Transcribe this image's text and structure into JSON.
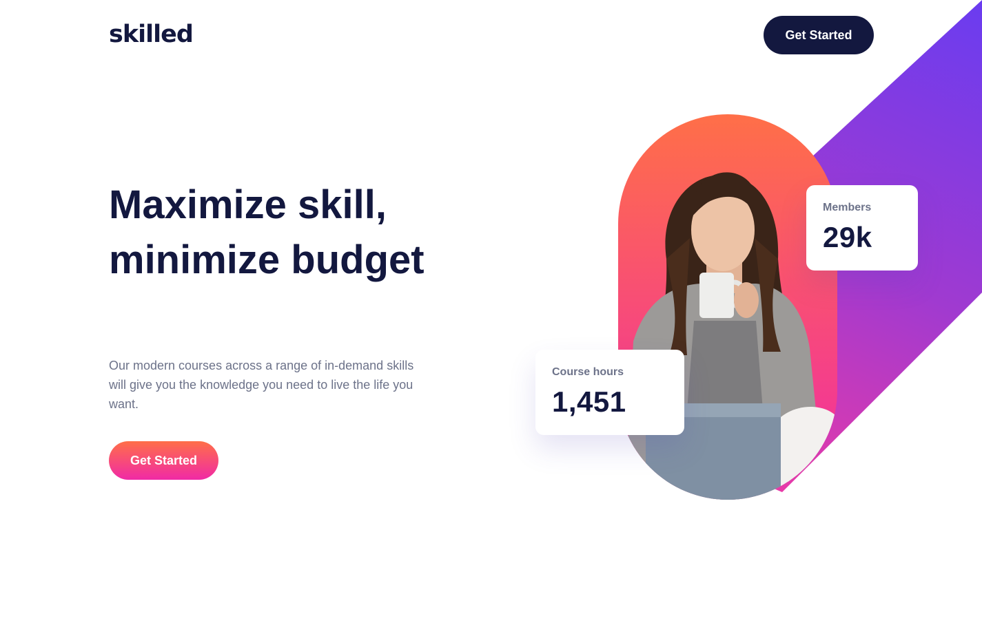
{
  "header": {
    "logo": "skilled",
    "cta_label": "Get Started"
  },
  "hero": {
    "title": "Maximize skill, minimize budget",
    "subtitle": "Our modern courses across a range of in-demand skills will give you the knowledge you need to live the life you want.",
    "cta_label": "Get Started"
  },
  "stats": {
    "members": {
      "label": "Members",
      "value": "29k"
    },
    "course_hours": {
      "label": "Course hours",
      "value": "1,451"
    }
  },
  "colors": {
    "navy": "#13183f",
    "gray_text": "#6c7289",
    "gradient_orange": "#ff6f48",
    "gradient_pink": "#f02aa6",
    "gradient_purple": "#6a3cf0"
  },
  "images": {
    "hero_photo": "woman-with-coffee-mug-and-laptop"
  }
}
